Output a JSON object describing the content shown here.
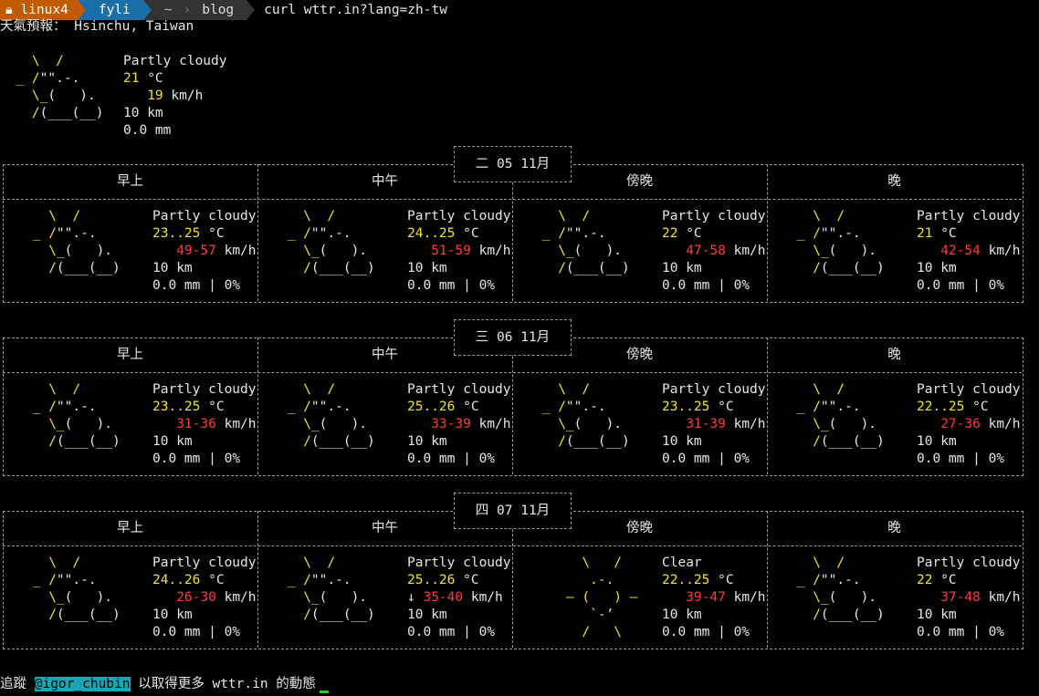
{
  "prompt": {
    "host": "linux4",
    "user": "fyli",
    "tilde": "~",
    "dir": "blog",
    "command": "curl wttr.in?lang=zh-tw"
  },
  "title": "天氣預報： Hsinchu, Taiwan",
  "current": {
    "condition": "Partly cloudy",
    "temp": "21",
    "temp_unit": " °C",
    "wind": "19",
    "wind_unit": " km/h",
    "visibility": "10 km",
    "precip": "0.0 mm"
  },
  "days": [
    {
      "date": "二 05 11月",
      "periods": [
        {
          "label": "早上",
          "condition": "Partly cloudy",
          "temp": "23..25",
          "wind": "49-57",
          "vis": "10 km",
          "precip": "0.0 mm | 0%"
        },
        {
          "label": "中午",
          "condition": "Partly cloudy",
          "temp": "24..25",
          "wind": "51-59",
          "vis": "10 km",
          "precip": "0.0 mm | 0%"
        },
        {
          "label": "傍晚",
          "condition": "Partly cloudy",
          "temp": "22",
          "wind": "47-58",
          "vis": "10 km",
          "precip": "0.0 mm | 0%"
        },
        {
          "label": "晚",
          "condition": "Partly cloudy",
          "temp": "21",
          "wind": "42-54",
          "vis": "10 km",
          "precip": "0.0 mm | 0%"
        }
      ]
    },
    {
      "date": "三 06 11月",
      "periods": [
        {
          "label": "早上",
          "condition": "Partly cloudy",
          "temp": "23..25",
          "wind": "31-36",
          "vis": "10 km",
          "precip": "0.0 mm | 0%"
        },
        {
          "label": "中午",
          "condition": "Partly cloudy",
          "temp": "25..26",
          "wind": "33-39",
          "vis": "10 km",
          "precip": "0.0 mm | 0%"
        },
        {
          "label": "傍晚",
          "condition": "Partly cloudy",
          "temp": "23..25",
          "wind": "31-39",
          "vis": "10 km",
          "precip": "0.0 mm | 0%"
        },
        {
          "label": "晚",
          "condition": "Partly cloudy",
          "temp": "22..25",
          "wind": "27-36",
          "vis": "10 km",
          "precip": "0.0 mm | 0%"
        }
      ]
    },
    {
      "date": "四 07 11月",
      "periods": [
        {
          "label": "早上",
          "condition": "Partly cloudy",
          "temp": "24..26",
          "wind": "26-30",
          "vis": "10 km",
          "precip": "0.0 mm | 0%"
        },
        {
          "label": "中午",
          "condition": "Partly cloudy",
          "temp": "25..26",
          "wind": "35-40",
          "wind_arrow": "↓",
          "vis": "10 km",
          "precip": "0.0 mm | 0%"
        },
        {
          "label": "傍晚",
          "condition": "Clear",
          "temp": "22..25",
          "wind": "39-47",
          "vis": "10 km",
          "precip": "0.0 mm | 0%",
          "clear": true
        },
        {
          "label": "晚",
          "condition": "Partly cloudy",
          "temp": "22",
          "wind": "37-48",
          "vis": "10 km",
          "precip": "0.0 mm | 0%"
        }
      ]
    }
  ],
  "units": {
    "temp": " °C",
    "wind": " km/h"
  },
  "footer": {
    "prefix": "追蹤 ",
    "handle": "@igor_chubin",
    "suffix": " 以取得更多 wttr.in 的動態"
  },
  "colors": {
    "sun": "#f2e22a",
    "wind": "#ff3b3b",
    "host": "#c25a00",
    "user": "#1b6fa8",
    "handle_bg": "#1ba6b6"
  }
}
